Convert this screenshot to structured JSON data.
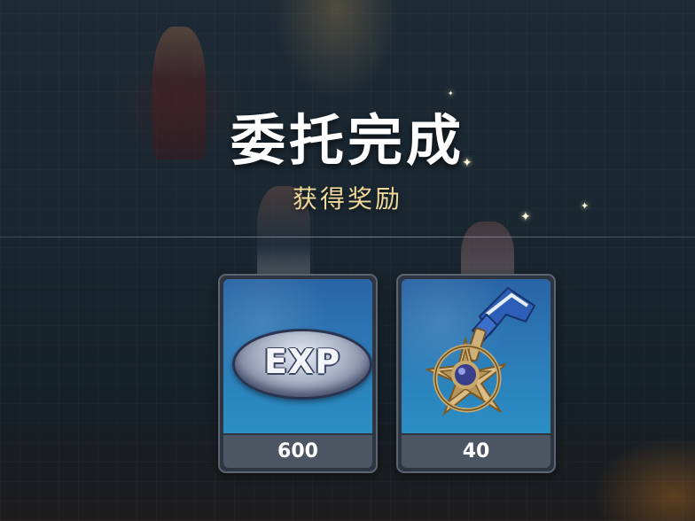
{
  "header": {
    "title": "委托完成",
    "subtitle": "获得奖励"
  },
  "rewards": [
    {
      "icon": "exp-icon",
      "label": "EXP",
      "count": "600"
    },
    {
      "icon": "star-compass-medal-icon",
      "count": "40"
    }
  ],
  "colors": {
    "title": "#ffffff",
    "subtitle": "#efd99b",
    "card_art": "#2b79b6",
    "card_count_bar": "#4c5562"
  }
}
